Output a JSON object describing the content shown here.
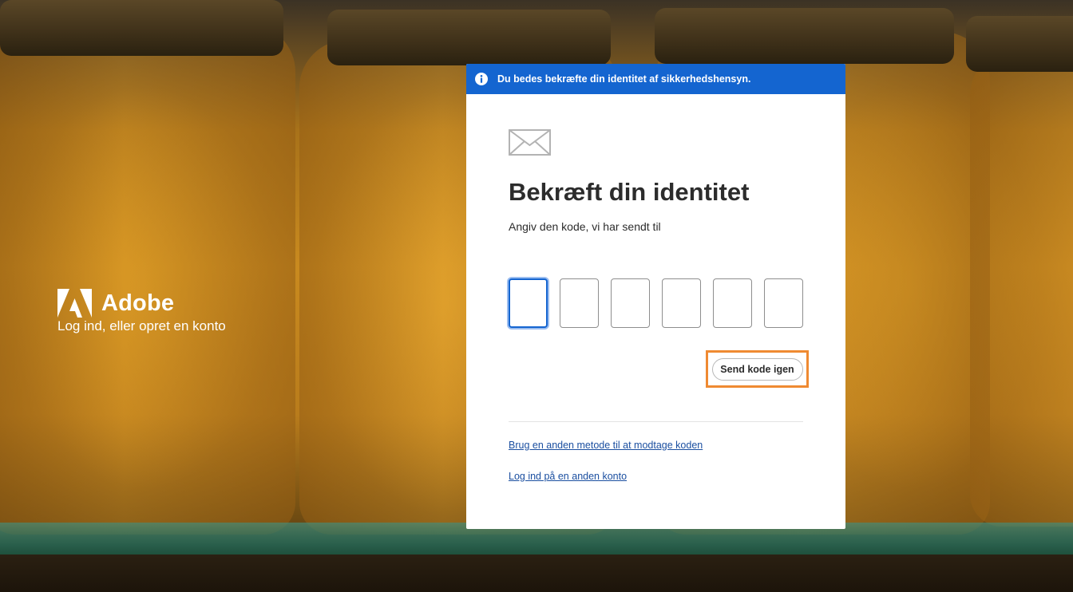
{
  "brand": {
    "name": "Adobe",
    "tagline": "Log ind, eller opret en konto"
  },
  "banner": {
    "icon": "info-icon",
    "text": "Du bedes bekræfte din identitet af sikkerhedshensyn."
  },
  "verify": {
    "icon": "mail-icon",
    "title": "Bekræft din identitet",
    "subtitle": "Angiv den kode, vi har sendt til",
    "code_digits": [
      "",
      "",
      "",
      "",
      "",
      ""
    ],
    "resend_label": "Send kode igen"
  },
  "links": {
    "other_method": "Brug en anden metode til at modtage koden",
    "other_account": "Log ind på en anden konto"
  },
  "colors": {
    "banner": "#1465d0",
    "highlight": "#ef8a32",
    "link": "#1b4fa0"
  }
}
